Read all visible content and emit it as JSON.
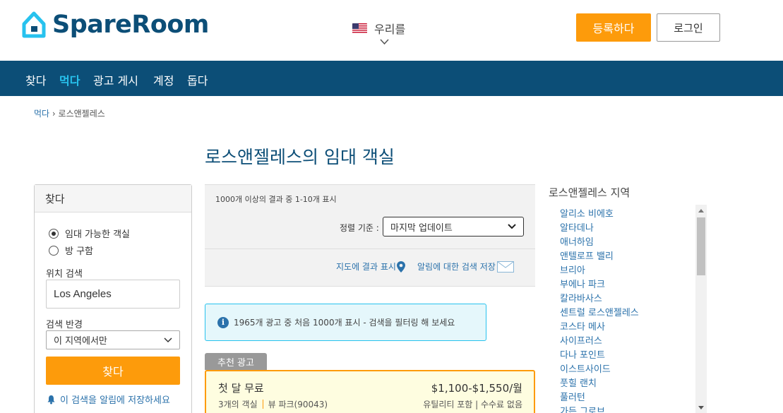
{
  "header": {
    "logo_text": "SpareRoom",
    "language": "우리를",
    "register_label": "등록하다",
    "login_label": "로그인"
  },
  "nav": {
    "items": [
      {
        "label": "찾다",
        "active": false
      },
      {
        "label": "먹다",
        "active": true
      },
      {
        "label": "광고 게시",
        "active": false
      },
      {
        "label": "계정",
        "active": false
      },
      {
        "label": "돕다",
        "active": false
      }
    ]
  },
  "breadcrumb": {
    "parent": "먹다",
    "separator": " › ",
    "current": "로스앤젤레스"
  },
  "page_title": "로스앤젤레스의 임대 객실",
  "search_panel": {
    "title": "찾다",
    "radio_options": [
      {
        "label": "임대 가능한 객실",
        "selected": true
      },
      {
        "label": "방 구함",
        "selected": false
      }
    ],
    "location_label": "위치 검색",
    "location_value": "Los Angeles",
    "radius_label": "검색 반경",
    "radius_value": "이 지역에서만",
    "find_button": "찾다",
    "save_alert_label": "이 검색을 알림에 저장하세요"
  },
  "results": {
    "count_text": "1000개 이상의 결과 중 1-10개 표시",
    "sort_label": "정렬 기준 :",
    "sort_value": "마지막 업데이트",
    "map_link": "지도에 결과 표시",
    "alert_link": "알림에 대한 검색 저장"
  },
  "notice": {
    "text": "1965개 광고 중 처음 1000개 표시 - 검색을 필터링 해 보세요"
  },
  "featured_listing": {
    "tag": "추천 광고",
    "title": "첫 달 무료",
    "price": "$1,100-$1,550/월",
    "rooms": "3개의 객실",
    "location": "뷰 파크(90043)",
    "extras": "유틸리티 포함 | 수수료 없음"
  },
  "areas": {
    "title": "로스앤젤레스 지역",
    "items": [
      "알리소 비에호",
      "알타데나",
      "애너하임",
      "앤텔로프 밸리",
      "브리아",
      "부에나 파크",
      "칼라바사스",
      "센트럴 로스앤젤레스",
      "코스타 메사",
      "사이프러스",
      "다나 포인트",
      "이스트사이드",
      "풋힐 랜치",
      "풀러턴",
      "가든 그로브"
    ]
  },
  "colors": {
    "brand_dark": "#0c4e77",
    "accent_orange": "#fd9b0b",
    "accent_cyan": "#27c2ee",
    "link_blue": "#2b72ab"
  }
}
